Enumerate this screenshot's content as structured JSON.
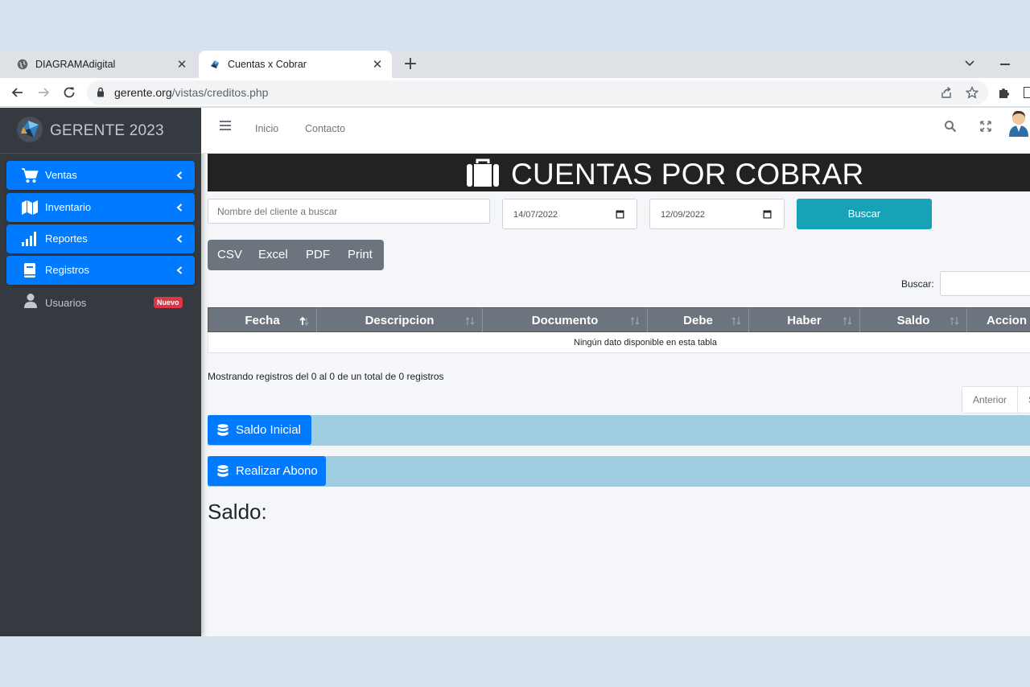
{
  "browser": {
    "tabs": [
      {
        "title": "DIAGRAMAdigital",
        "active": false
      },
      {
        "title": "Cuentas x Cobrar",
        "active": true
      }
    ],
    "url_host": "gerente.org",
    "url_path": "/vistas/creditos.php"
  },
  "sidebar": {
    "brand": "GERENTE 2023",
    "items": [
      {
        "label": "Ventas",
        "icon": "cart-icon"
      },
      {
        "label": "Inventario",
        "icon": "map-icon"
      },
      {
        "label": "Reportes",
        "icon": "signal-bars-icon"
      },
      {
        "label": "Registros",
        "icon": "book-icon"
      }
    ],
    "users": {
      "label": "Usuarios",
      "badge": "Nuevo"
    }
  },
  "topnav": {
    "links": [
      "Inicio",
      "Contacto"
    ]
  },
  "page": {
    "title": "CUENTAS POR COBRAR",
    "filters": {
      "client_placeholder": "Nombre del cliente a buscar",
      "date_from": "14/07/2022",
      "date_to": "12/09/2022",
      "search_button": "Buscar"
    },
    "export_buttons": [
      "CSV",
      "Excel",
      "PDF",
      "Print"
    ],
    "table_search_label": "Buscar:",
    "table": {
      "columns": [
        "Fecha",
        "Descripcion",
        "Documento",
        "Debe",
        "Haber",
        "Saldo",
        "Accion"
      ],
      "empty_message": "Ningún dato disponible en esta tabla",
      "info": "Mostrando registros del 0 al 0 de un total de 0 registros",
      "pager_prev": "Anterior",
      "pager_next": "Siguiente"
    },
    "actions": {
      "saldo_inicial": "Saldo Inicial",
      "realizar_abono": "Realizar Abono"
    },
    "saldo_label": "Saldo:"
  },
  "colors": {
    "sidebar_bg": "#343a40",
    "primary": "#007bff",
    "info": "#17a2b8",
    "secondary": "#6c757d",
    "danger": "#dc3545",
    "title_bar": "#222222",
    "strip": "#a0cde0"
  }
}
